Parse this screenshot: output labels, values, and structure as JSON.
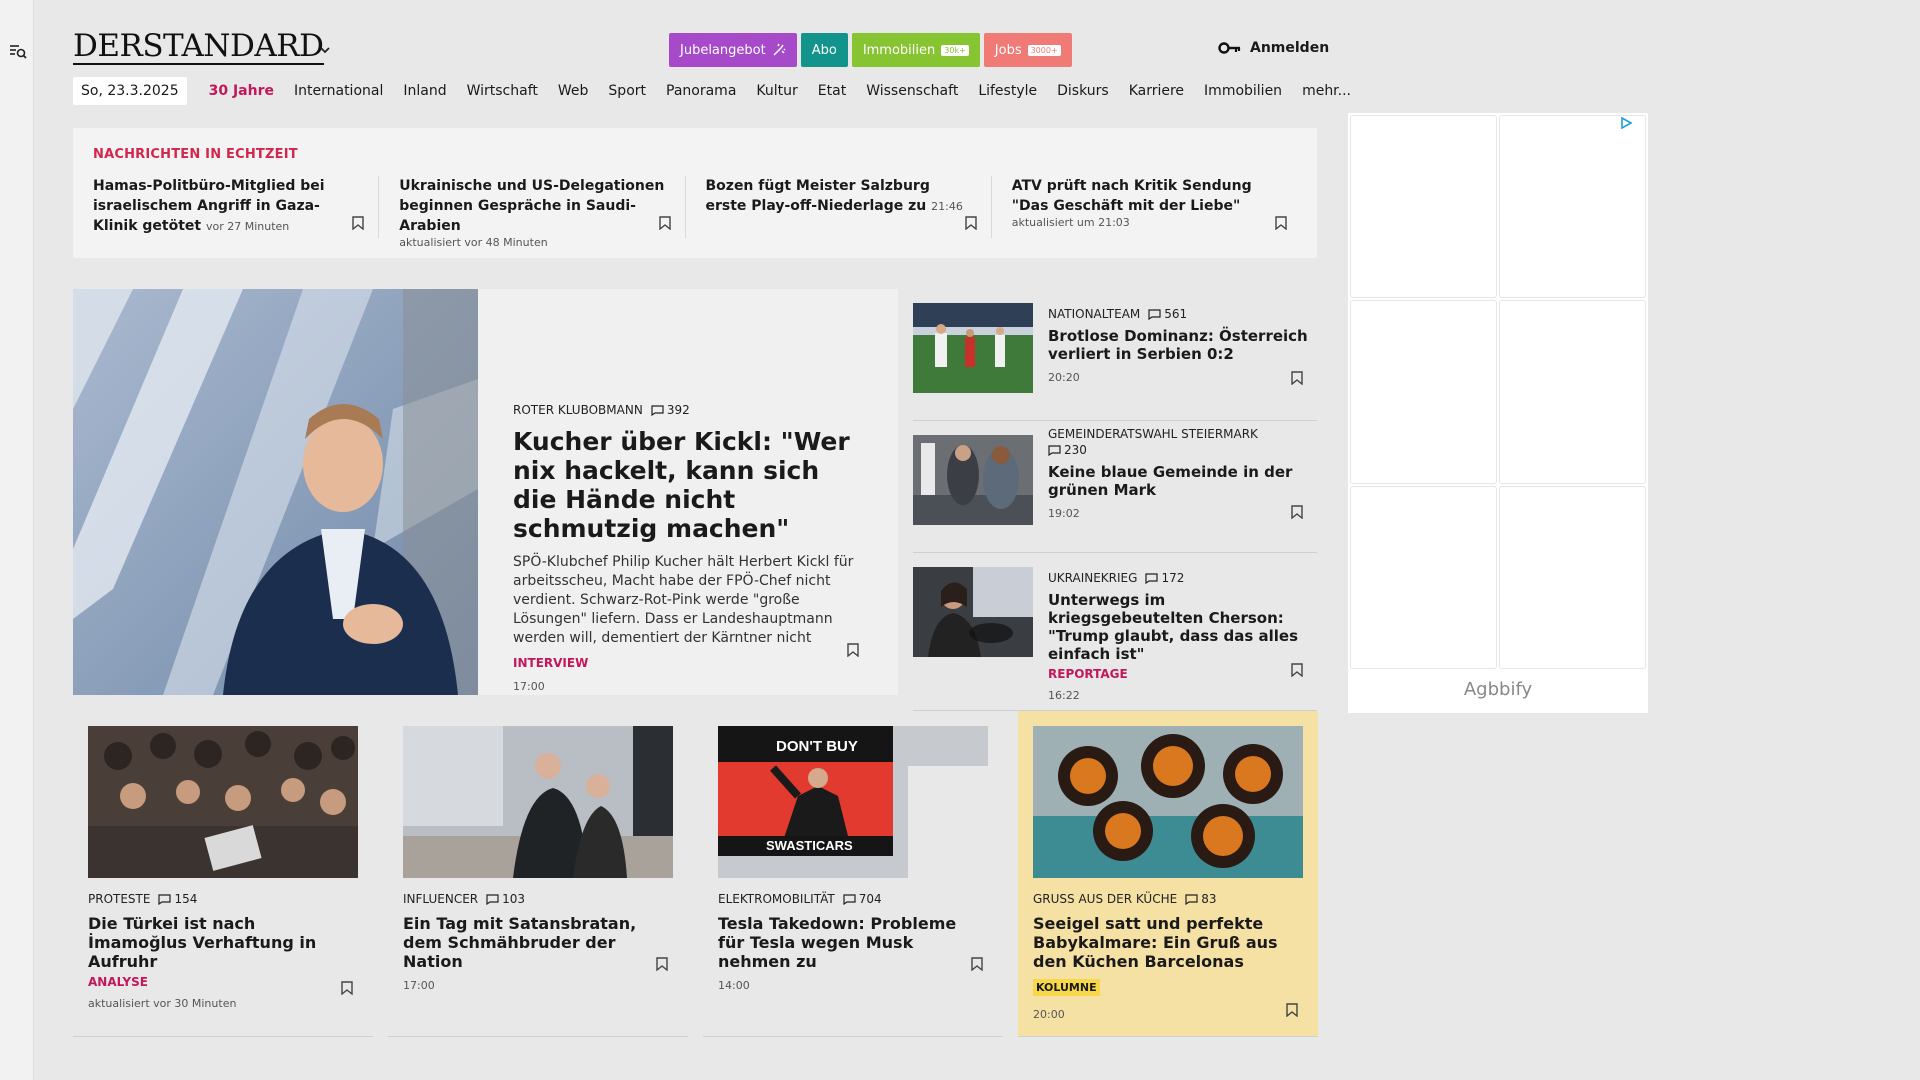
{
  "header": {
    "logo_text": "DERSTANDARD",
    "promo": {
      "jubel": "Jubelangebot",
      "abo": "Abo",
      "immo": "Immobilien",
      "immo_tag": "30k+",
      "jobs": "Jobs",
      "jobs_tag": "3000+"
    },
    "login_label": "Anmelden"
  },
  "nav": {
    "date": "So, 23.3.2025",
    "items": [
      "30 Jahre",
      "International",
      "Inland",
      "Wirtschaft",
      "Web",
      "Sport",
      "Panorama",
      "Kultur",
      "Etat",
      "Wissenschaft",
      "Lifestyle",
      "Diskurs",
      "Karriere",
      "Immobilien",
      "mehr..."
    ]
  },
  "ticker": {
    "label": "NACHRICHTEN IN ECHTZEIT",
    "items": [
      {
        "headline": "Hamas-Politbüro-Mitglied bei israelischem Angriff in Gaza-Klinik getötet",
        "meta": "vor 27 Minuten"
      },
      {
        "headline": "Ukrainische und US-Delegationen beginnen Gespräche in Saudi-Arabien",
        "meta": "aktualisiert vor 48 Minuten"
      },
      {
        "headline": "Bozen fügt Meister Salzburg erste Play-off-Niederlage zu",
        "meta": "21:46"
      },
      {
        "headline": "ATV prüft nach Kritik Sendung \"Das Geschäft mit der Liebe\"",
        "meta": "aktualisiert um 21:03"
      }
    ]
  },
  "feature": {
    "kicker": "ROTER KLUBOBMANN",
    "comments": "392",
    "title": "Kucher über Kickl: \"Wer nix hackelt, kann sich die Hände nicht schmutzig machen\"",
    "lead": "SPÖ-Klubchef Philip Kucher hält Herbert Kickl für arbeitsscheu, Macht habe der FPÖ-Chef nicht verdient. Schwarz-Rot-Pink werde \"große Lösungen\" liefern. Dass er Landeshauptmann werden will, dementiert der Kärntner nicht",
    "badge": "INTERVIEW",
    "time": "17:00"
  },
  "side": [
    {
      "kicker": "NATIONALTEAM",
      "comments": "561",
      "title": "Brotlose Dominanz: Österreich verliert in Serbien 0:2",
      "badge": "",
      "time": "20:20"
    },
    {
      "kicker": "GEMEINDERATSWAHL STEIERMARK",
      "comments": "230",
      "title": "Keine blaue Gemeinde in der grünen Mark",
      "badge": "",
      "time": "19:02"
    },
    {
      "kicker": "UKRAINEKRIEG",
      "comments": "172",
      "title": "Unterwegs im kriegsgebeutelten Cherson: \"Trump glaubt, dass das alles einfach ist\"",
      "badge": "REPORTAGE",
      "time": "16:22"
    }
  ],
  "cards": [
    {
      "kicker": "PROTESTE",
      "comments": "154",
      "title": "Die Türkei ist nach İmamoğlus Verhaftung in Aufruhr",
      "badge": "ANALYSE",
      "time": "aktualisiert vor 30 Minuten"
    },
    {
      "kicker": "INFLUENCER",
      "comments": "103",
      "title": "Ein Tag mit Satansbratan, dem Schmähbruder der Nation",
      "badge": "",
      "time": "17:00"
    },
    {
      "kicker": "ELEKTROMOBILITÄT",
      "comments": "704",
      "title": "Tesla Takedown: Probleme für Tesla wegen Musk nehmen zu",
      "badge": "",
      "time": "14:00",
      "sign_top": "DON'T BUY",
      "sign_bottom": "SWASTICARS"
    },
    {
      "kicker": "GRUSS AUS DER KÜCHE",
      "comments": "83",
      "title": "Seeigel satt und perfekte Babykalmare: Ein Gruß aus den Küchen Barcelonas",
      "badge": "KOLUMNE",
      "time": "20:00"
    }
  ],
  "ad": {
    "brand": "Agbbify"
  },
  "colors": {
    "accent_pink": "#c2185b",
    "ticker_red": "#d3264c",
    "jubel": "#a64ac9",
    "abo": "#12948c",
    "immo": "#86c431",
    "jobs": "#ef7a76",
    "kolumne_bg": "#f5e1a4"
  },
  "icons": [
    "search-menu-icon",
    "chevron-down-icon",
    "key-icon",
    "bookmark-icon",
    "comment-icon",
    "ad-choices-icon",
    "sparkle-icon"
  ]
}
